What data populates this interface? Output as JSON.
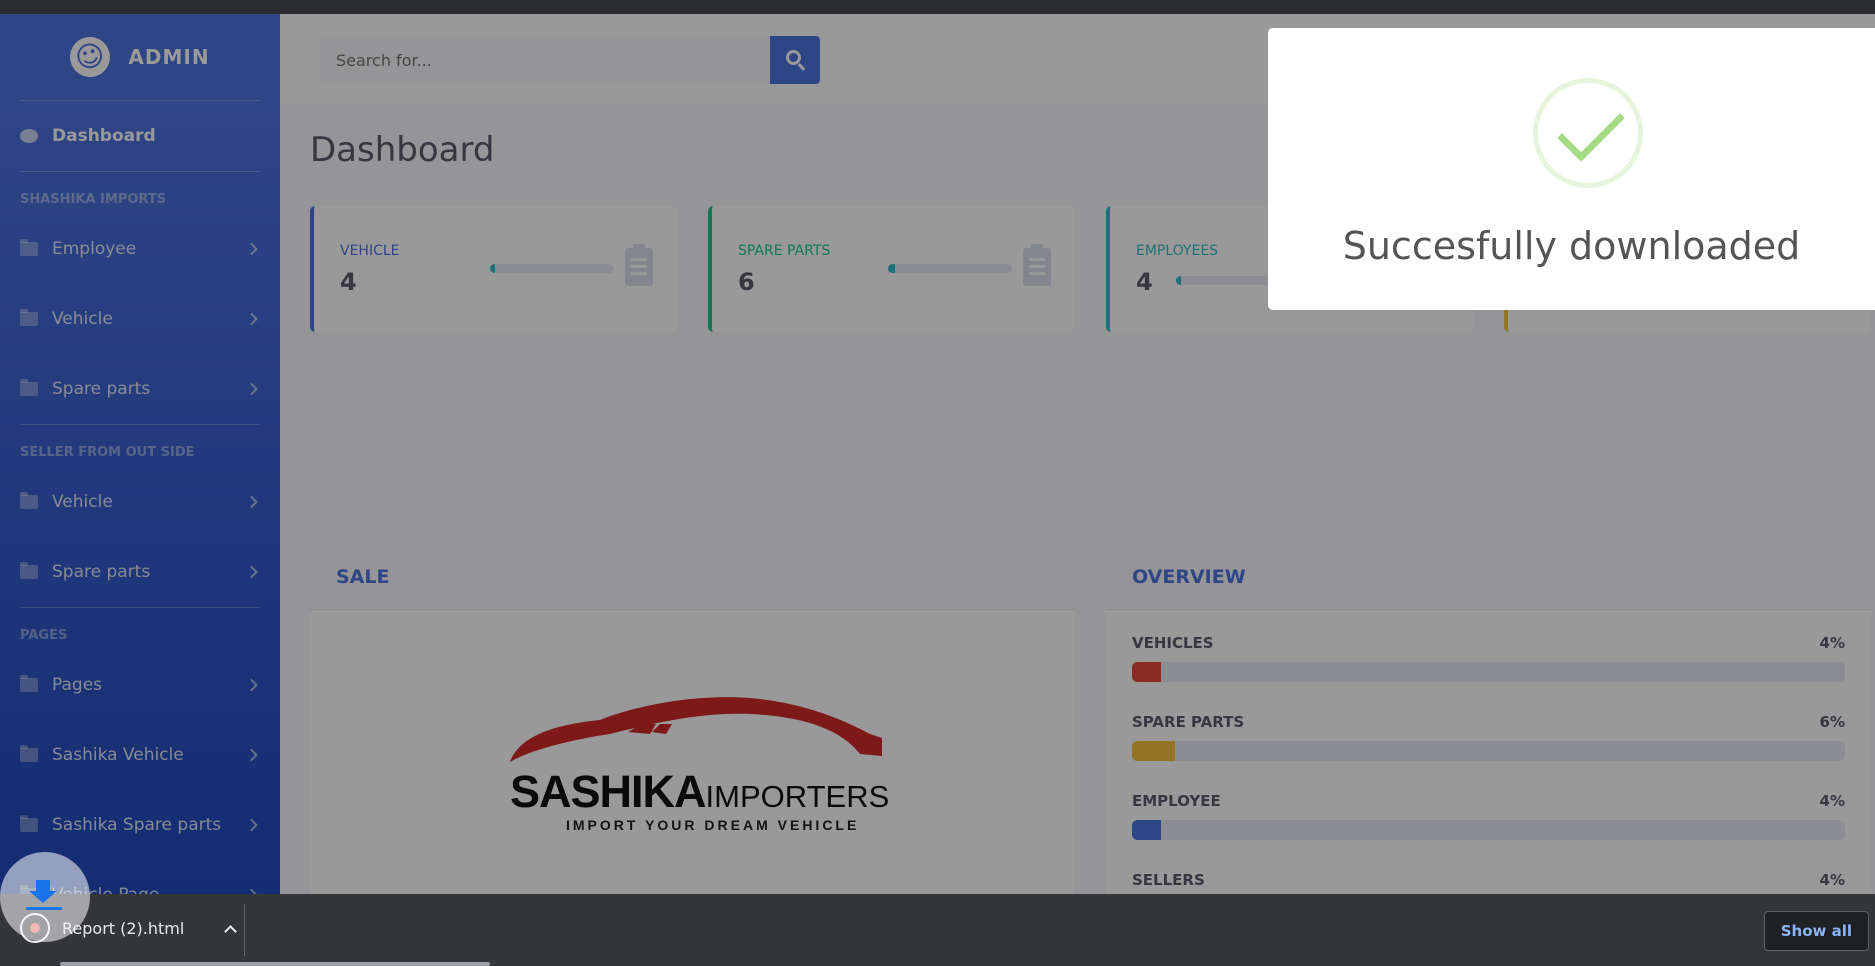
{
  "brand": {
    "title": "ADMIN"
  },
  "search": {
    "placeholder": "Search for..."
  },
  "sidebar": {
    "dashboard": "Dashboard",
    "sections": [
      {
        "heading": "SHASHIKA IMPORTS",
        "items": [
          "Employee",
          "Vehicle",
          "Spare parts"
        ]
      },
      {
        "heading": "SELLER FROM OUT SIDE",
        "items": [
          "Vehicle",
          "Spare parts"
        ]
      },
      {
        "heading": "PAGES",
        "items": [
          "Pages",
          "Sashika Vehicle",
          "Sashika Spare parts",
          "Vehicle Page"
        ]
      }
    ]
  },
  "page": {
    "title": "Dashboard"
  },
  "cards": [
    {
      "label": "VEHICLE",
      "value": "4",
      "progress": 0.04,
      "color": "#4e73df"
    },
    {
      "label": "SPARE PARTS",
      "value": "6",
      "progress": 0.06,
      "color": "#1cc88a"
    },
    {
      "label": "EMPLOYEES",
      "value": "4",
      "progress": 0.04,
      "color": "#36b9cc"
    },
    {
      "label": "",
      "value": "",
      "progress": 0,
      "color": "#f6c23e"
    }
  ],
  "sale": {
    "title": "SALE",
    "logo_main": "SASHIKA",
    "logo_secondary": "IMPORTERS",
    "logo_tagline": "IMPORT YOUR DREAM VEHICLE"
  },
  "overview": {
    "title": "OVERVIEW",
    "rows": [
      {
        "name": "VEHICLES",
        "pct": "4%",
        "fraction": 0.04,
        "color": "#e74a3b"
      },
      {
        "name": "SPARE PARTS",
        "pct": "6%",
        "fraction": 0.06,
        "color": "#f6c23e"
      },
      {
        "name": "EMPLOYEE",
        "pct": "4%",
        "fraction": 0.04,
        "color": "#4e73df"
      },
      {
        "name": "SELLERS",
        "pct": "4%",
        "fraction": 0.04,
        "color": "#36b9cc"
      }
    ]
  },
  "toast": {
    "message": "Succesfully downloaded"
  },
  "downloads": {
    "filename": "Report (2).html",
    "show_all": "Show all"
  }
}
